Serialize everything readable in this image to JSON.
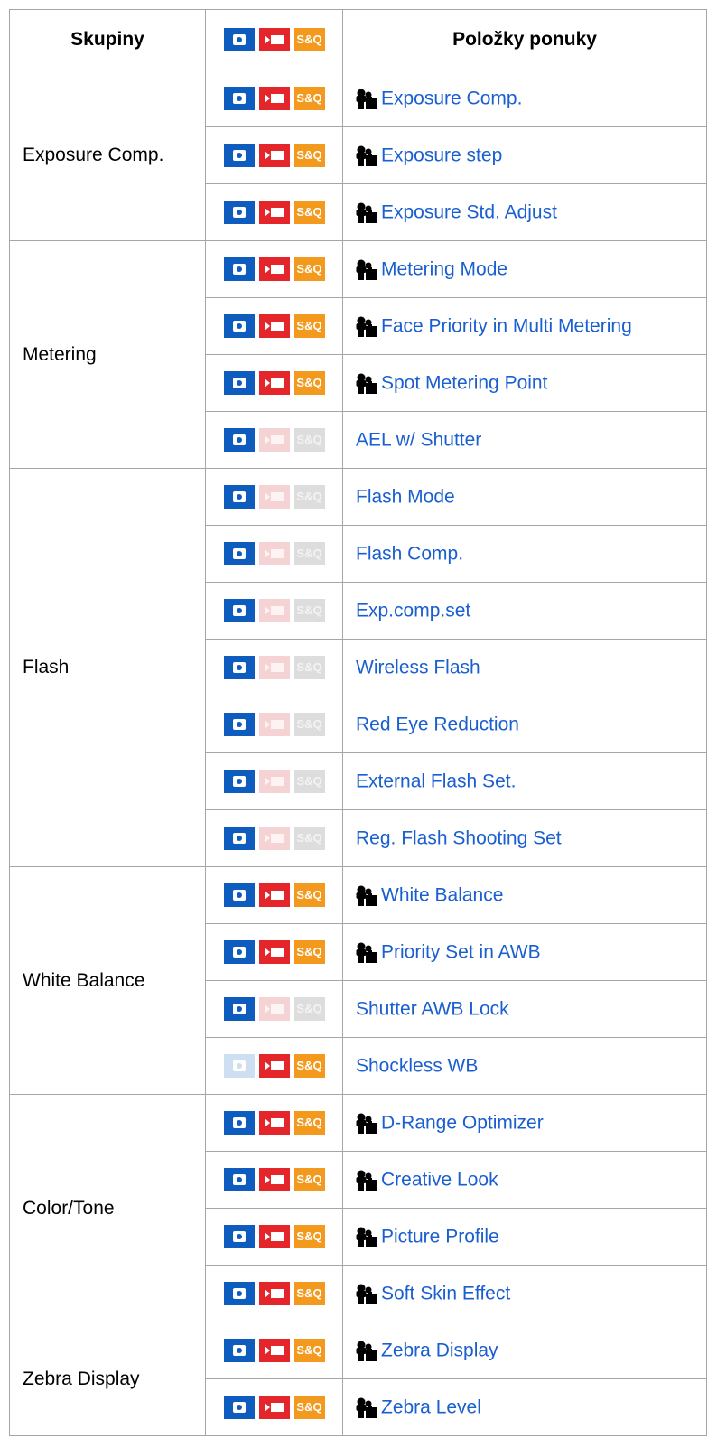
{
  "header": {
    "groups": "Skupiny",
    "items": "Položky ponuky",
    "badges": {
      "photo": "photo-mode-icon",
      "movie": "movie-mode-icon",
      "sq": "S&Q"
    }
  },
  "colors": {
    "photo": "#0e5cbd",
    "movie": "#e4262b",
    "sq": "#f39a1e",
    "link": "#1a5fd0",
    "border": "#a6a6a6"
  },
  "groups": [
    {
      "name": "Exposure Comp.",
      "rows": [
        {
          "label": "Exposure Comp.",
          "setting_icon": true,
          "photo": true,
          "movie": true,
          "sq": true
        },
        {
          "label": "Exposure step",
          "setting_icon": true,
          "photo": true,
          "movie": true,
          "sq": true
        },
        {
          "label": "Exposure Std. Adjust",
          "setting_icon": true,
          "photo": true,
          "movie": true,
          "sq": true
        }
      ]
    },
    {
      "name": "Metering",
      "rows": [
        {
          "label": "Metering Mode",
          "setting_icon": true,
          "photo": true,
          "movie": true,
          "sq": true
        },
        {
          "label": "Face Priority in Multi Metering",
          "setting_icon": true,
          "photo": true,
          "movie": true,
          "sq": true
        },
        {
          "label": "Spot Metering Point",
          "setting_icon": true,
          "photo": true,
          "movie": true,
          "sq": true
        },
        {
          "label": "AEL w/ Shutter",
          "setting_icon": false,
          "photo": true,
          "movie": false,
          "sq": false
        }
      ]
    },
    {
      "name": "Flash",
      "rows": [
        {
          "label": "Flash Mode",
          "setting_icon": false,
          "photo": true,
          "movie": false,
          "sq": false
        },
        {
          "label": "Flash Comp.",
          "setting_icon": false,
          "photo": true,
          "movie": false,
          "sq": false
        },
        {
          "label": "Exp.comp.set",
          "setting_icon": false,
          "photo": true,
          "movie": false,
          "sq": false
        },
        {
          "label": "Wireless Flash",
          "setting_icon": false,
          "photo": true,
          "movie": false,
          "sq": false
        },
        {
          "label": "Red Eye Reduction",
          "setting_icon": false,
          "photo": true,
          "movie": false,
          "sq": false
        },
        {
          "label": "External Flash Set.",
          "setting_icon": false,
          "photo": true,
          "movie": false,
          "sq": false
        },
        {
          "label": "Reg. Flash Shooting Set",
          "setting_icon": false,
          "photo": true,
          "movie": false,
          "sq": false
        }
      ]
    },
    {
      "name": "White Balance",
      "rows": [
        {
          "label": "White Balance",
          "setting_icon": true,
          "photo": true,
          "movie": true,
          "sq": true
        },
        {
          "label": "Priority Set in AWB",
          "setting_icon": true,
          "photo": true,
          "movie": true,
          "sq": true
        },
        {
          "label": "Shutter AWB Lock",
          "setting_icon": false,
          "photo": true,
          "movie": false,
          "sq": false
        },
        {
          "label": "Shockless WB",
          "setting_icon": false,
          "photo": false,
          "movie": true,
          "sq": true
        }
      ]
    },
    {
      "name": "Color/Tone",
      "rows": [
        {
          "label": "D-Range Optimizer",
          "setting_icon": true,
          "photo": true,
          "movie": true,
          "sq": true
        },
        {
          "label": "Creative Look",
          "setting_icon": true,
          "photo": true,
          "movie": true,
          "sq": true
        },
        {
          "label": "Picture Profile",
          "setting_icon": true,
          "photo": true,
          "movie": true,
          "sq": true
        },
        {
          "label": "Soft Skin Effect",
          "setting_icon": true,
          "photo": true,
          "movie": true,
          "sq": true
        }
      ]
    },
    {
      "name": "Zebra Display",
      "rows": [
        {
          "label": "Zebra Display",
          "setting_icon": true,
          "photo": true,
          "movie": true,
          "sq": true
        },
        {
          "label": "Zebra Level",
          "setting_icon": true,
          "photo": true,
          "movie": true,
          "sq": true
        }
      ]
    }
  ]
}
